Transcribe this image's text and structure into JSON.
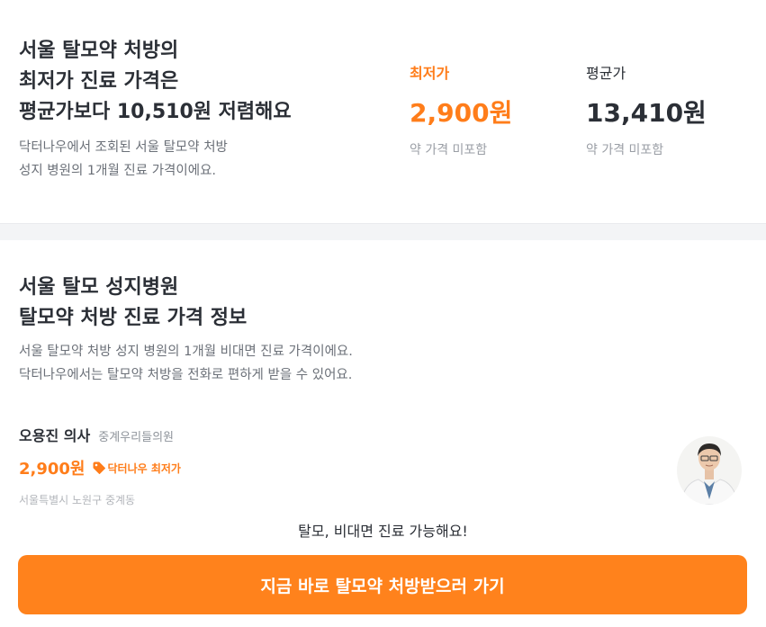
{
  "summary": {
    "headline": [
      "서울 탈모약 처방의",
      "최저가 진료 가격은",
      "평균가보다 10,510원 저렴해요"
    ],
    "description": [
      "닥터나우에서 조회된 서울 탈모약 처방",
      "성지 병원의 1개월 진료 가격이에요."
    ],
    "lowest": {
      "label": "최저가",
      "value": "2,900원",
      "note": "약 가격 미포함"
    },
    "average": {
      "label": "평균가",
      "value": "13,410원",
      "note": "약 가격 미포함"
    }
  },
  "section": {
    "title": [
      "서울 탈모 성지병원",
      "탈모약 처방 진료 가격 정보"
    ],
    "description": [
      "서울 탈모약 처방 성지 병원의 1개월 비대면 진료 가격이에요.",
      "닥터나우에서는 탈모약 처방을 전화로 편하게 받을 수 있어요."
    ],
    "doctor": {
      "name": "오용진 의사",
      "clinic": "중계우리들의원",
      "fee": "2,900원",
      "badge": "닥터나우 최저가",
      "address": "서울특별시 노원구 중계동"
    },
    "notice": "탈모, 비대면 진료 가능해요!",
    "cta_label": "지금 바로 탈모약 처방받으러 가기"
  },
  "colors": {
    "accent": "#ff7d1a",
    "cta": "#ff821c",
    "text": "#2b2f36",
    "muted": "#6b7078"
  }
}
